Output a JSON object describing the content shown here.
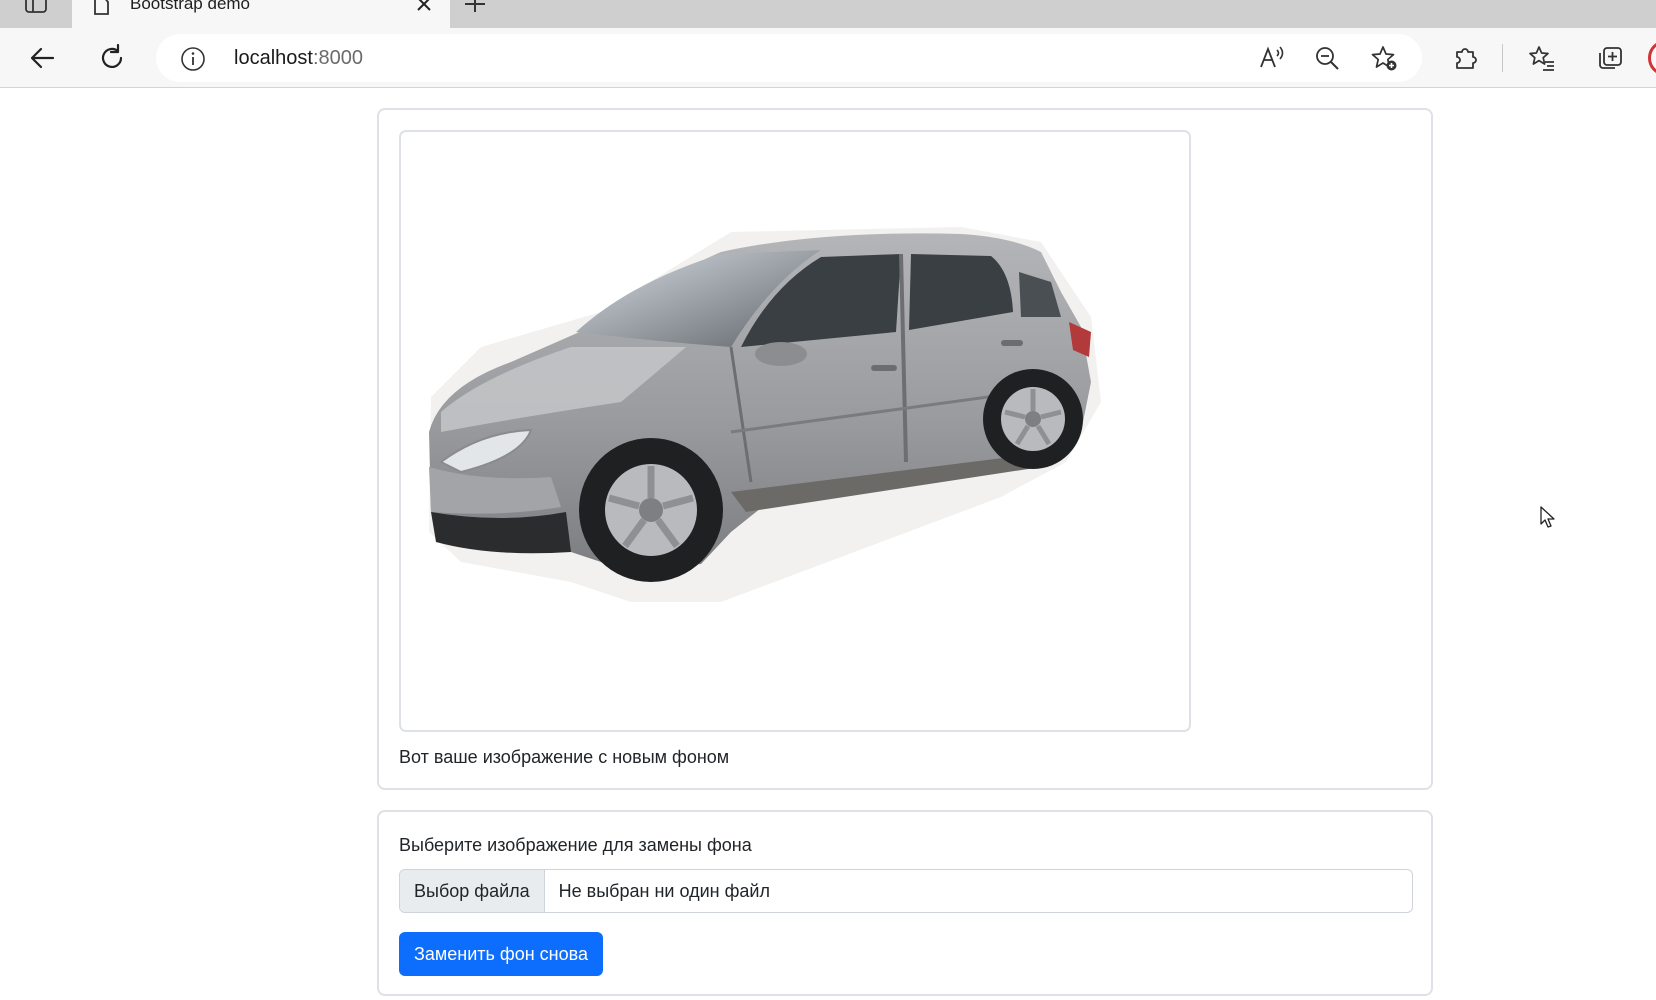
{
  "browser": {
    "tab_title": "Bootstrap demo",
    "url_host": "localhost",
    "url_port": ":8000",
    "icons": {
      "sidebar": "sidebar-icon",
      "tab": "page-icon",
      "close": "close-icon",
      "new_tab": "plus-icon",
      "back": "back-arrow-icon",
      "refresh": "refresh-icon",
      "info": "info-icon",
      "read_aloud": "read-aloud-icon",
      "zoom_out": "zoom-out-icon",
      "favorite": "add-favorite-icon",
      "extensions": "puzzle-icon",
      "favorites": "favorites-list-icon",
      "collections": "collections-icon"
    }
  },
  "result": {
    "image_alt": "car-image",
    "caption": "Вот ваше изображение с новым фоном"
  },
  "form": {
    "label": "Выберите изображение для замены фона",
    "file_button": "Выбор файла",
    "file_status": "Не выбран ни один файл",
    "submit": "Заменить фон снова"
  },
  "colors": {
    "primary": "#0d6efd",
    "border": "#dee2e6",
    "profile_ring": "#d13438"
  }
}
